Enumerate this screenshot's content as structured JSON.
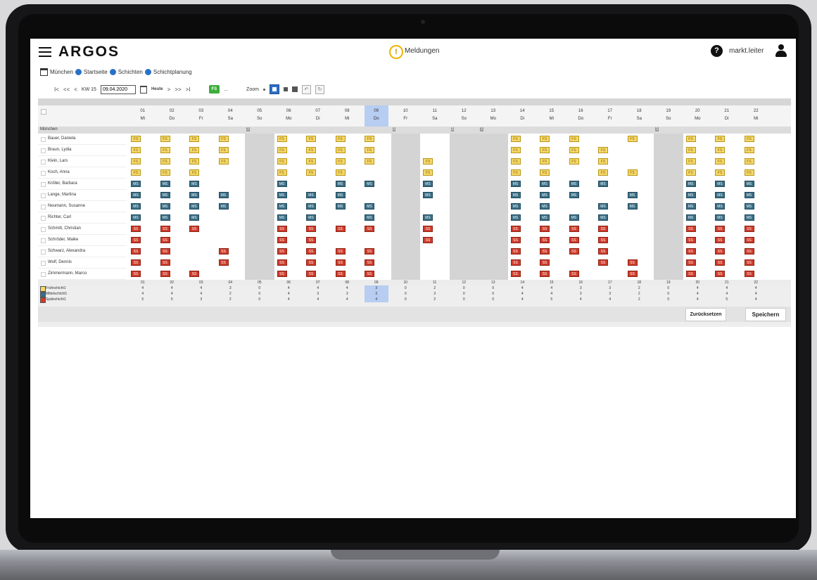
{
  "app": {
    "brand": "ARGOS",
    "notifications_label": "Meldungen",
    "username": "markt.leiter"
  },
  "breadcrumb": [
    "München",
    "Startseite",
    "Schichten",
    "Schichtplanung"
  ],
  "toolbar": {
    "first": "I<",
    "prev_fast": "<<",
    "prev": "<",
    "week_label": "KW 15",
    "date_value": "09.04.2020",
    "today_label": "Heute",
    "next": ">",
    "next_fast": ">>",
    "last": ">I",
    "fs_label": "FS",
    "dots": "...",
    "zoom_label": "Zoom"
  },
  "days": [
    {
      "num": "01",
      "wd": "Mi"
    },
    {
      "num": "02",
      "wd": "Do"
    },
    {
      "num": "03",
      "wd": "Fr"
    },
    {
      "num": "04",
      "wd": "Sa"
    },
    {
      "num": "05",
      "wd": "So"
    },
    {
      "num": "06",
      "wd": "Mo"
    },
    {
      "num": "07",
      "wd": "Di"
    },
    {
      "num": "08",
      "wd": "Mi"
    },
    {
      "num": "09",
      "wd": "Do"
    },
    {
      "num": "10",
      "wd": "Fr"
    },
    {
      "num": "11",
      "wd": "Sa"
    },
    {
      "num": "12",
      "wd": "So"
    },
    {
      "num": "13",
      "wd": "Mo"
    },
    {
      "num": "14",
      "wd": "Di"
    },
    {
      "num": "15",
      "wd": "Mi"
    },
    {
      "num": "16",
      "wd": "Do"
    },
    {
      "num": "17",
      "wd": "Fr"
    },
    {
      "num": "18",
      "wd": "Sa"
    },
    {
      "num": "19",
      "wd": "So"
    },
    {
      "num": "20",
      "wd": "Mo"
    },
    {
      "num": "21",
      "wd": "Di"
    },
    {
      "num": "22",
      "wd": "Mi"
    }
  ],
  "selected_day_index": 8,
  "closed_day_indices": [
    4,
    9,
    11,
    12,
    18
  ],
  "group_label": "München",
  "group_markers": [
    "3",
    "3",
    "3",
    "3",
    "3"
  ],
  "employees": [
    {
      "name": "Bauer, Daniela",
      "shifts": [
        "FS",
        "FS",
        "FS",
        "FS",
        "",
        "FS",
        "FS",
        "FS",
        "FS",
        "",
        "",
        "",
        "",
        "FS",
        "FS",
        "FS",
        "",
        "FS",
        "",
        "FS",
        "FS",
        "FS"
      ]
    },
    {
      "name": "Braun, Lydia",
      "shifts": [
        "FS",
        "FS",
        "FS",
        "FS",
        "",
        "FS",
        "FS",
        "FS",
        "FS",
        "",
        "",
        "",
        "",
        "FS",
        "FS",
        "FS",
        "FS",
        "",
        "",
        "FS",
        "FS",
        "FS"
      ]
    },
    {
      "name": "Klein, Lars",
      "shifts": [
        "FS",
        "FS",
        "FS",
        "FS",
        "",
        "FS",
        "FS",
        "FS",
        "FS",
        "",
        "FS",
        "",
        "",
        "FS",
        "FS",
        "FS",
        "FS",
        "",
        "",
        "FS",
        "FS",
        "FS"
      ]
    },
    {
      "name": "Koch, Anna",
      "shifts": [
        "FS",
        "FS",
        "FS",
        "",
        "",
        "FS",
        "FS",
        "FS",
        "",
        "",
        "FS",
        "",
        "",
        "FS",
        "FS",
        "",
        "FS",
        "FS",
        "",
        "FS",
        "FS",
        "FS"
      ]
    },
    {
      "name": "Kröller, Barbara",
      "shifts": [
        "MS",
        "MS",
        "MS",
        "",
        "",
        "MS",
        "",
        "MS",
        "MS",
        "",
        "MS",
        "",
        "",
        "MS",
        "MS",
        "MS",
        "MS",
        "",
        "",
        "MS",
        "MS",
        "MS"
      ]
    },
    {
      "name": "Lange, Martina",
      "shifts": [
        "MS",
        "MS",
        "MS",
        "MS",
        "",
        "MS",
        "MS",
        "MS",
        "",
        "",
        "MS",
        "",
        "",
        "MS",
        "MS",
        "MS",
        "",
        "MS",
        "",
        "MS",
        "MS",
        "MS"
      ]
    },
    {
      "name": "Neumann, Susanne",
      "shifts": [
        "MS",
        "MS",
        "MS",
        "MS",
        "",
        "MS",
        "MS",
        "MS",
        "MS",
        "",
        "",
        "",
        "",
        "MS",
        "MS",
        "",
        "MS",
        "MS",
        "",
        "MS",
        "MS",
        "MS"
      ]
    },
    {
      "name": "Richter, Carl",
      "shifts": [
        "MS",
        "MS",
        "MS",
        "",
        "",
        "MS",
        "MS",
        "",
        "MS",
        "",
        "MS",
        "",
        "",
        "MS",
        "MS",
        "MS",
        "MS",
        "",
        "",
        "MS",
        "MS",
        "MS"
      ]
    },
    {
      "name": "Schmitt, Christian",
      "shifts": [
        "SS",
        "SS",
        "SS",
        "",
        "",
        "SS",
        "SS",
        "SS",
        "SS",
        "",
        "SS",
        "",
        "",
        "SS",
        "SS",
        "SS",
        "SS",
        "",
        "",
        "SS",
        "SS",
        "SS"
      ]
    },
    {
      "name": "Schröder, Maike",
      "shifts": [
        "SS",
        "SS",
        "",
        "",
        "",
        "SS",
        "SS",
        "",
        "",
        "",
        "SS",
        "",
        "",
        "SS",
        "SS",
        "SS",
        "SS",
        "",
        "",
        "SS",
        "SS",
        "SS"
      ]
    },
    {
      "name": "Schwarz, Alexandra",
      "shifts": [
        "SS",
        "SS",
        "",
        "SS",
        "",
        "SS",
        "SS",
        "SS",
        "SS",
        "",
        "",
        "",
        "",
        "SS",
        "SS",
        "SS",
        "SS",
        "",
        "",
        "SS",
        "SS",
        "SS"
      ]
    },
    {
      "name": "Wolf, Dennis",
      "shifts": [
        "SS",
        "SS",
        "",
        "SS",
        "",
        "SS",
        "SS",
        "SS",
        "SS",
        "",
        "",
        "",
        "",
        "SS",
        "SS",
        "",
        "SS",
        "SS",
        "",
        "SS",
        "SS",
        "SS"
      ]
    },
    {
      "name": "Zimmermann, Marco",
      "shifts": [
        "SS",
        "SS",
        "SS",
        "",
        "",
        "SS",
        "SS",
        "SS",
        "SS",
        "",
        "",
        "",
        "",
        "SS",
        "SS",
        "SS",
        "",
        "SS",
        "",
        "SS",
        "SS",
        "SS"
      ]
    }
  ],
  "summary": [
    {
      "label": "Frühschicht1",
      "color": "#f5d76a",
      "values": [
        "4",
        "4",
        "4",
        "3",
        "0",
        "4",
        "4",
        "4",
        "3",
        "0",
        "2",
        "0",
        "0",
        "4",
        "4",
        "3",
        "3",
        "2",
        "0",
        "4",
        "4",
        "4"
      ]
    },
    {
      "label": "Mittelschicht1",
      "color": "#3a6e86",
      "values": [
        "4",
        "4",
        "4",
        "2",
        "0",
        "4",
        "3",
        "3",
        "3",
        "0",
        "3",
        "0",
        "0",
        "4",
        "4",
        "3",
        "3",
        "2",
        "0",
        "4",
        "4",
        "4"
      ]
    },
    {
      "label": "Spätschicht1",
      "color": "#cf3b2a",
      "values": [
        "5",
        "5",
        "3",
        "2",
        "0",
        "4",
        "4",
        "4",
        "4",
        "0",
        "2",
        "0",
        "0",
        "4",
        "5",
        "4",
        "4",
        "2",
        "0",
        "4",
        "5",
        "4"
      ]
    }
  ],
  "buttons": {
    "reset": "Zurücksetzen",
    "save": "Speichern"
  },
  "colors": {
    "accent": "#2a6fc8",
    "fs": "#f5d76a",
    "ms": "#3a6e86",
    "ss": "#cf3b2a",
    "today_highlight": "#b7cdf2"
  }
}
